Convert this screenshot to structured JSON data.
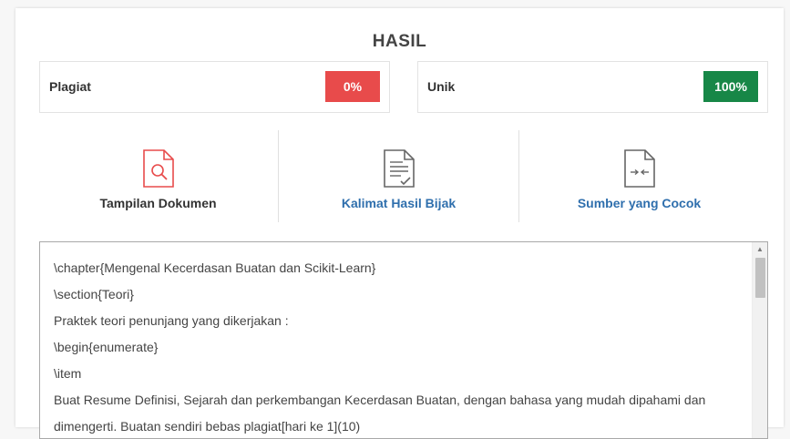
{
  "header": {
    "title": "HASIL"
  },
  "scores": {
    "plagiarism": {
      "label": "Plagiat",
      "value": "0%",
      "color": "#e84b4b"
    },
    "unique": {
      "label": "Unik",
      "value": "100%",
      "color": "#178747"
    }
  },
  "tools": [
    {
      "label": "Tampilan Dokumen",
      "icon": "document-search-icon",
      "color": "#333333"
    },
    {
      "label": "Kalimat Hasil Bijak",
      "icon": "document-check-icon",
      "color": "#2f6fad"
    },
    {
      "label": "Sumber yang Cocok",
      "icon": "document-compare-icon",
      "color": "#2f6fad"
    }
  ],
  "document": {
    "lines": [
      "\\chapter{Mengenal Kecerdasan Buatan dan Scikit-Learn}",
      "\\section{Teori}",
      "Praktek teori penunjang yang dikerjakan :",
      "\\begin{enumerate}",
      "\\item",
      "Buat Resume Definisi, Sejarah dan perkembangan Kecerdasan Buatan, dengan bahasa yang mudah dipahami dan",
      "dimengerti. Buatan sendiri bebas plagiat[hari ke 1](10)"
    ]
  },
  "colors": {
    "accent_link": "#2f6fad",
    "danger": "#e84b4b",
    "success": "#178747"
  }
}
